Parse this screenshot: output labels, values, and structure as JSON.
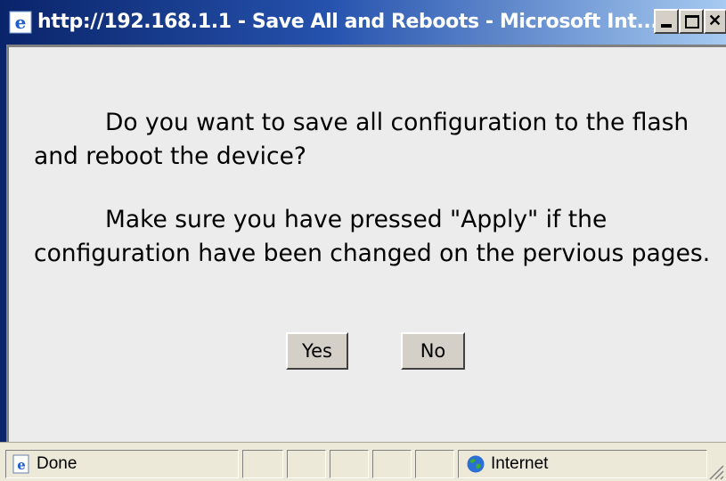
{
  "window": {
    "title": "http://192.168.1.1 - Save All and Reboots - Microsoft Int...",
    "icons": {
      "app": "ie-icon",
      "minimize": "minimize-icon",
      "maximize": "maximize-icon",
      "close": "close-icon"
    }
  },
  "dialog": {
    "message1": "Do you want to save all configuration to the flash and reboot the device?",
    "message2": "Make sure you have pressed \"Apply\" if the configuration have been changed on the pervious pages.",
    "yes_label": "Yes",
    "no_label": "No"
  },
  "statusbar": {
    "status": "Done",
    "zone": "Internet"
  },
  "colors": {
    "title_gradient_start": "#0a246a",
    "title_gradient_end": "#a6caf0",
    "client_bg": "#ececec",
    "chrome_bg": "#d4d0c8"
  }
}
